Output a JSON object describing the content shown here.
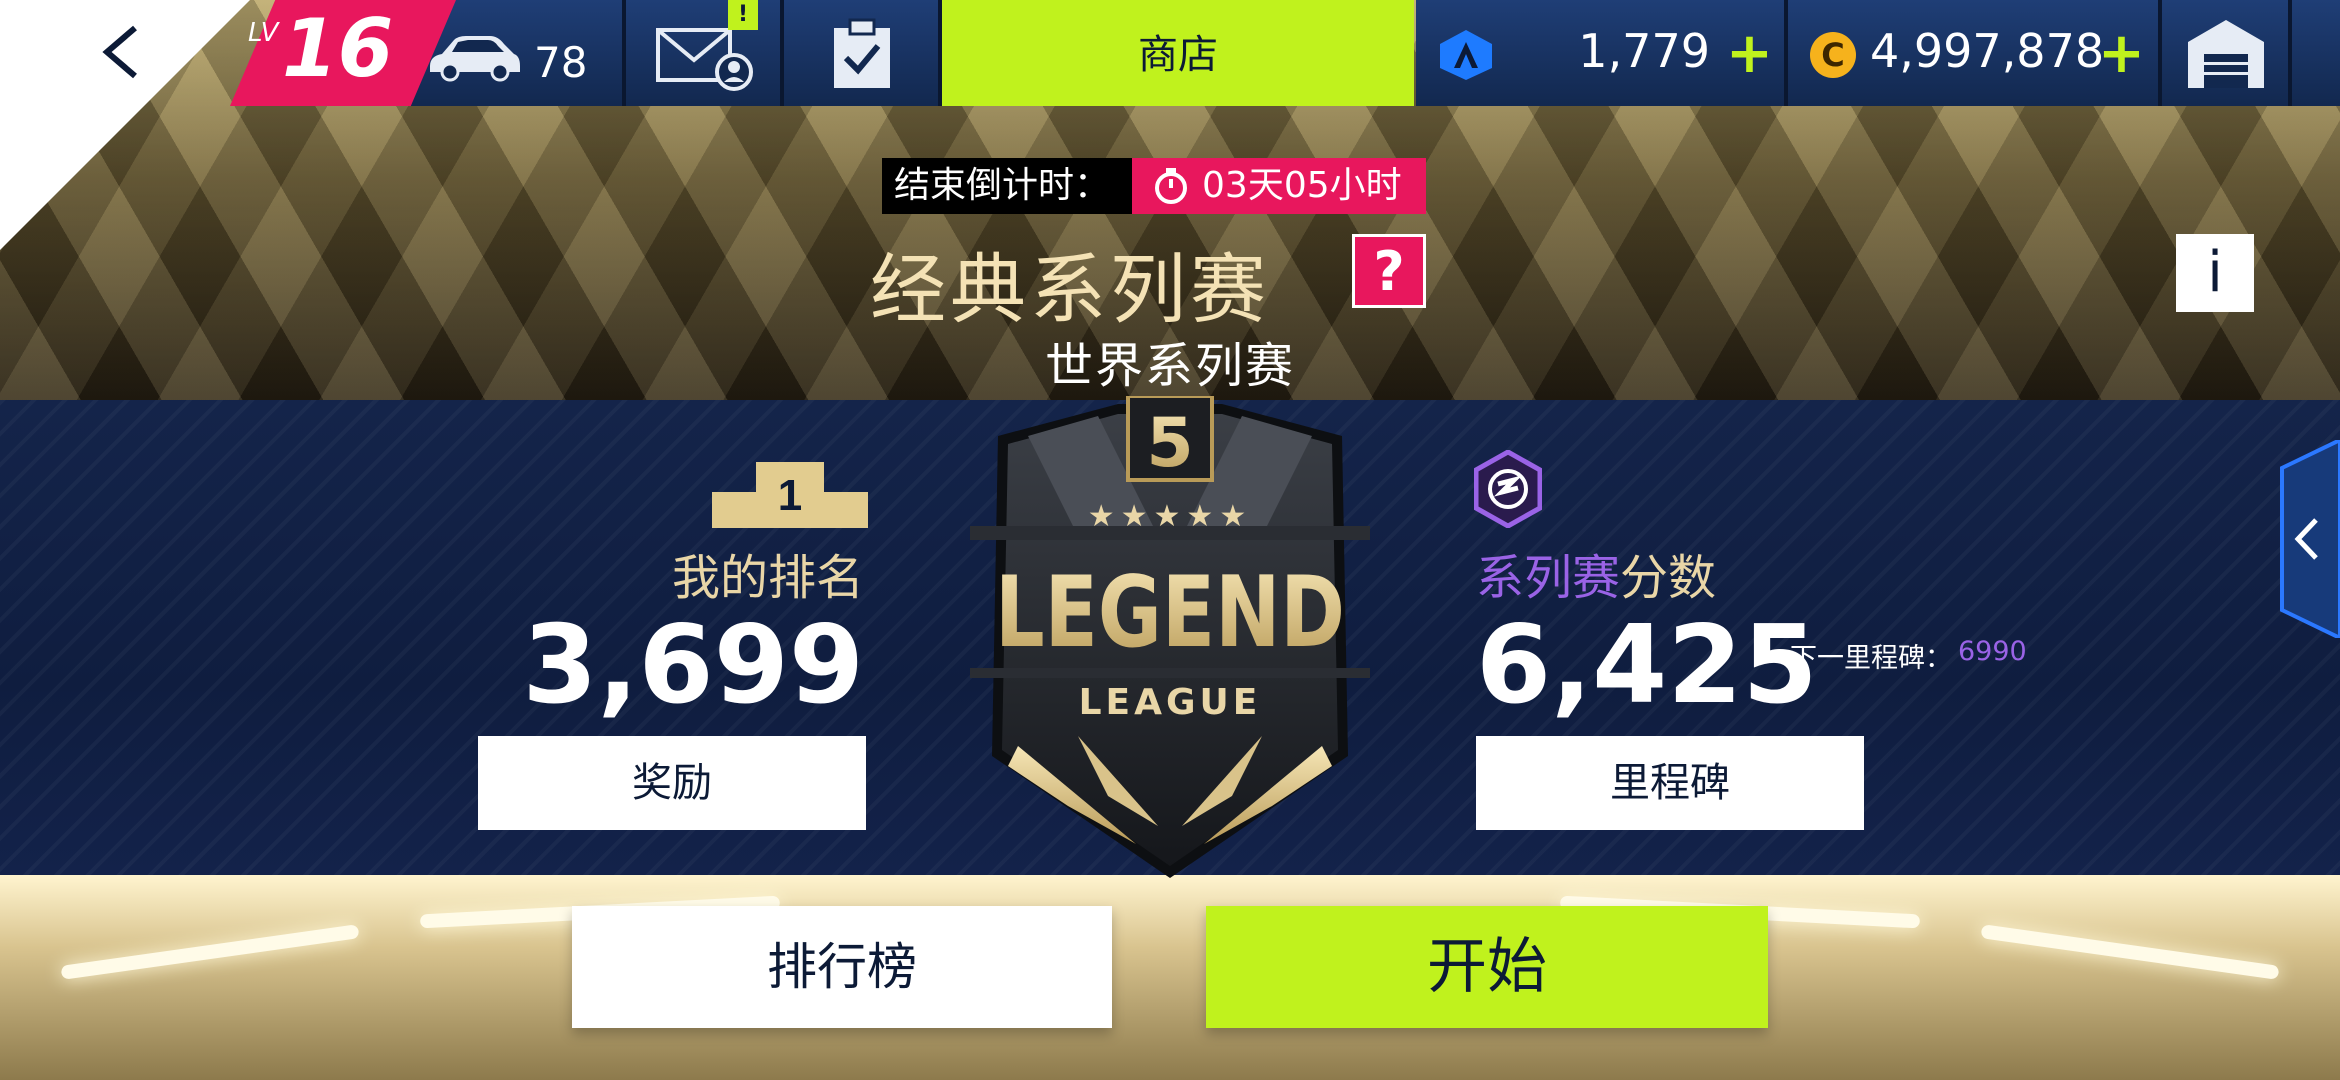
{
  "colors": {
    "accent_green": "#c0f21d",
    "accent_pink": "#e8175d",
    "accent_purple": "#9a63e6",
    "gold_text": "#e9d6a7",
    "navy": "#0c1a36"
  },
  "topbar": {
    "back_icon": "chevron-left-icon",
    "level_prefix": "LV",
    "level": "16",
    "cars_icon": "car-icon",
    "cars_count": "78",
    "mail_icon": "mail-profile-icon",
    "mail_badge": "!",
    "tasks_icon": "clipboard-check-icon",
    "shop_label": "商店",
    "tokens_icon": "token-icon",
    "tokens_value": "1,779",
    "tokens_plus": "+",
    "credits_icon_letter": "C",
    "credits_value": "4,997,878",
    "credits_plus": "+",
    "home_icon": "garage-home-icon"
  },
  "header": {
    "countdown_label": "结束倒计时：",
    "countdown_value": "03天05小时",
    "title": "经典系列赛",
    "help_label": "?",
    "subtitle": "世界系列赛",
    "info_label": "i"
  },
  "ranking": {
    "podium_number": "1",
    "label": "我的排名",
    "value": "3,699",
    "rewards_button": "奖励"
  },
  "emblem": {
    "tier_number": "5",
    "stars": "★★★★★",
    "title": "LEGEND",
    "subtitle": "LEAGUE"
  },
  "series_score": {
    "label_accent": "系列赛",
    "label_rest": "分数",
    "value": "6,425",
    "next_milestone_label": "下一里程碑：",
    "next_milestone_value": "6990",
    "milestones_button": "里程碑"
  },
  "actions": {
    "leaderboard_button": "排行榜",
    "start_button": "开始"
  }
}
